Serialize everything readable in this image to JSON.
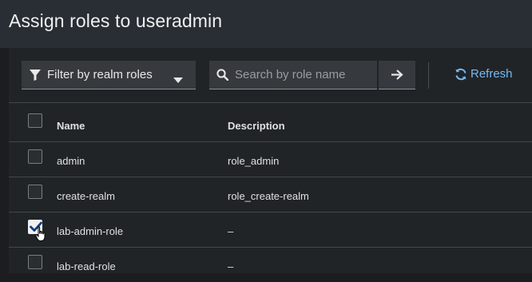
{
  "modal": {
    "title": "Assign roles to useradmin"
  },
  "toolbar": {
    "filter_label": "Filter by realm roles",
    "search_placeholder": "Search by role name",
    "refresh_label": "Refresh"
  },
  "table": {
    "columns": {
      "name": "Name",
      "description": "Description"
    },
    "rows": [
      {
        "name": "admin",
        "description": "role_admin",
        "checked": false
      },
      {
        "name": "create-realm",
        "description": "role_create-realm",
        "checked": false
      },
      {
        "name": "lab-admin-role",
        "description": "–",
        "checked": true
      },
      {
        "name": "lab-read-role",
        "description": "–",
        "checked": false
      }
    ]
  },
  "colors": {
    "accent": "#73bcf7",
    "background": "#1b1d21",
    "panel": "#212427",
    "header": "#292e34"
  },
  "icons": {
    "filter": "filter-icon",
    "caret": "caret-down-icon",
    "search": "search-icon",
    "arrow": "arrow-right-icon",
    "refresh": "sync-icon",
    "check": "check-icon",
    "cursor": "hand-pointer-icon"
  }
}
